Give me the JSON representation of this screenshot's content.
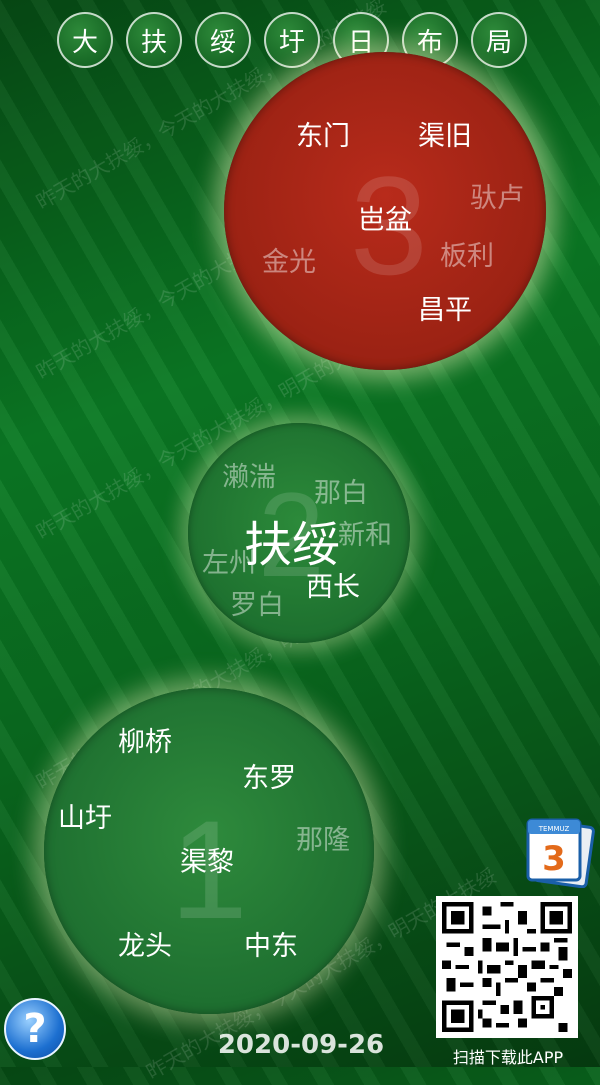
{
  "watermark": "昨天的大扶绥，今天的大扶绥，明天的大扶绥",
  "top_buttons": [
    "大",
    "扶",
    "绥",
    "圩",
    "日",
    "布",
    "局"
  ],
  "circle_3": {
    "number": "3",
    "places": [
      {
        "name": "东门",
        "active": true
      },
      {
        "name": "渠旧",
        "active": true
      },
      {
        "name": "驮卢",
        "active": false
      },
      {
        "name": "岜盆",
        "active": true
      },
      {
        "name": "金光",
        "active": false
      },
      {
        "name": "板利",
        "active": false
      },
      {
        "name": "昌平",
        "active": true
      }
    ]
  },
  "circle_2": {
    "number": "2",
    "center": "扶绥",
    "places": [
      {
        "name": "濑湍",
        "active": false
      },
      {
        "name": "那白",
        "active": false
      },
      {
        "name": "新和",
        "active": false
      },
      {
        "name": "左州",
        "active": false
      },
      {
        "name": "西长",
        "active": true
      },
      {
        "name": "罗白",
        "active": false
      }
    ]
  },
  "circle_1": {
    "number": "1",
    "places": [
      {
        "name": "柳桥",
        "active": true
      },
      {
        "name": "东罗",
        "active": true
      },
      {
        "name": "山圩",
        "active": true
      },
      {
        "name": "那隆",
        "active": false
      },
      {
        "name": "渠黎",
        "active": true
      },
      {
        "name": "龙头",
        "active": true
      },
      {
        "name": "中东",
        "active": true
      }
    ]
  },
  "help_label": "?",
  "date": "2020-09-26",
  "calendar_number": "3",
  "calendar_header": "TEMMUZ",
  "qr_label": "扫描下载此APP",
  "colors": {
    "active_circle": "#b82b1b",
    "inactive_circle": "#2c8a3a",
    "background": "#0b7a24"
  }
}
